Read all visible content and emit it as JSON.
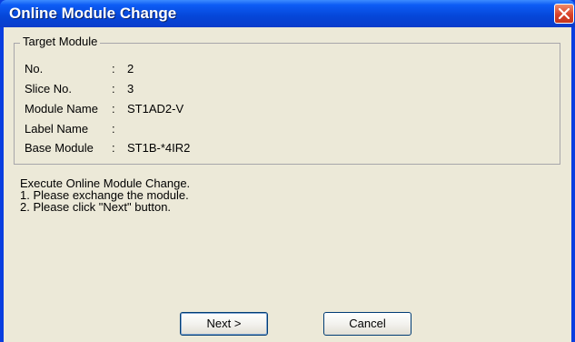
{
  "window": {
    "title": "Online Module Change"
  },
  "target_module": {
    "group_label": "Target Module",
    "fields": [
      {
        "label": "No.",
        "colon": ":",
        "value": "2"
      },
      {
        "label": "Slice No.",
        "colon": ":",
        "value": "3"
      },
      {
        "label": "Module Name",
        "colon": ":",
        "value": "ST1AD2-V"
      },
      {
        "label": "Label Name",
        "colon": ":",
        "value": ""
      },
      {
        "label": "Base Module",
        "colon": ":",
        "value": "ST1B-*4IR2"
      }
    ]
  },
  "instructions": {
    "line1": "Execute Online Module Change.",
    "line2": "1. Please exchange the module.",
    "line3": "2. Please click \"Next\" button."
  },
  "buttons": {
    "next_label": "Next >",
    "cancel_label": "Cancel"
  },
  "icons": {
    "close": "close-icon"
  },
  "colors": {
    "titlebar": "#0546d8",
    "dialog_background": "#ece9d8",
    "close_button": "#d8422a"
  }
}
